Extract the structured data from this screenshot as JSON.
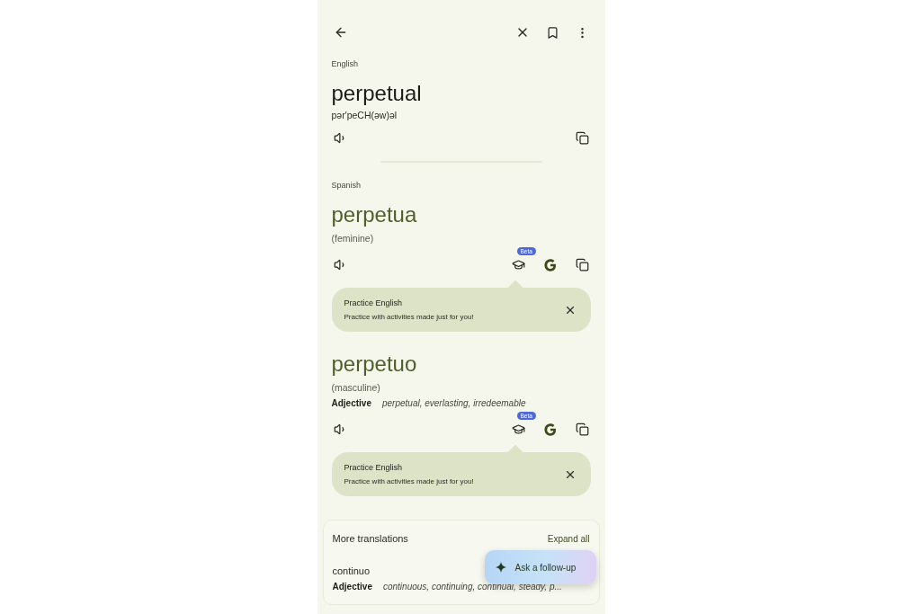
{
  "source": {
    "language": "English",
    "word": "perpetual",
    "pronunciation": "pər'peCH(əw)əl"
  },
  "target": {
    "language": "Spanish",
    "entries": [
      {
        "word": "perpetua",
        "gender": "(feminine)",
        "badge": "Beta",
        "tip": {
          "title": "Practice English",
          "body": "Practice with activities made just for you!"
        }
      },
      {
        "word": "perpetuo",
        "gender": "(masculine)",
        "pos": "Adjective",
        "synonyms": "perpetual, everlasting, irredeemable",
        "badge": "Beta",
        "tip": {
          "title": "Practice English",
          "body": "Practice with activities made just for you!"
        }
      }
    ]
  },
  "more_translations": {
    "title": "More translations",
    "action": "Expand all",
    "items": [
      {
        "word": "continuo",
        "pos": "Adjective",
        "synonyms": "continuous, continuing, continual, steady, p..."
      }
    ]
  },
  "fab": {
    "label": "Ask a follow-up"
  }
}
